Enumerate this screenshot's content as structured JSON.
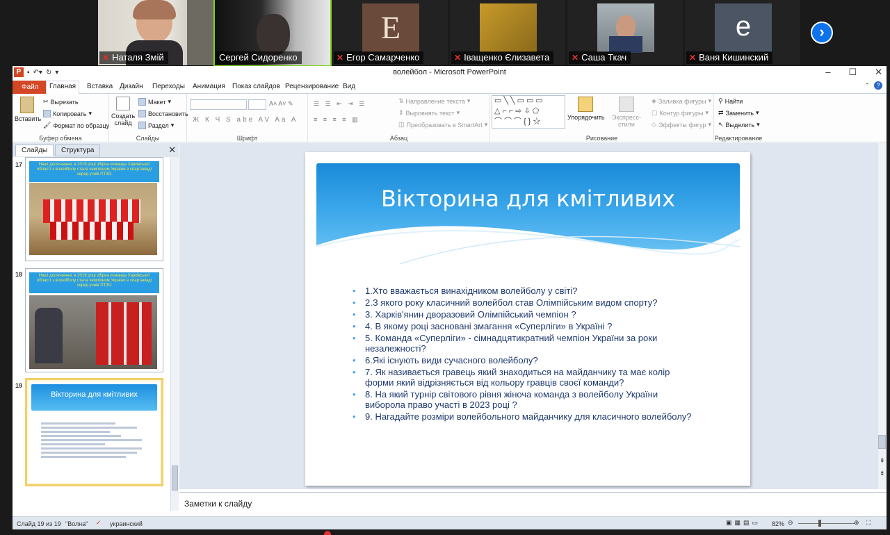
{
  "meeting": {
    "participants": [
      {
        "name": "Наталя Змій",
        "video": "face"
      },
      {
        "name": "Сергей Сидоренко",
        "video": "dark"
      },
      {
        "name": "Егор Самарченко",
        "video": "letter-e"
      },
      {
        "name": "Іващенко Єлизавета",
        "video": "orange"
      },
      {
        "name": "Саша Ткач",
        "video": "face2"
      },
      {
        "name": "Ваня Кишинский",
        "video": "avatar"
      }
    ],
    "avatar_letter": "e",
    "next_icon": "chevron-right-icon"
  },
  "window": {
    "title": "волейбол - Microsoft PowerPoint",
    "qat_icon": "P",
    "controls": [
      "–",
      "☐",
      "✕"
    ]
  },
  "tabs": [
    "Файл",
    "Главная",
    "Вставка",
    "Дизайн",
    "Переходы",
    "Анимация",
    "Показ слайдов",
    "Рецензирование",
    "Вид"
  ],
  "ribbon": {
    "clipboard": {
      "paste": "Вставить",
      "cut": "Вырезать",
      "copy": "Копировать",
      "format": "Формат по образцу",
      "label": "Буфер обмена"
    },
    "slides": {
      "new": "Создать",
      "new2": "слайд",
      "layout": "Макет",
      "reset": "Восстановить",
      "section": "Раздел",
      "label": "Слайды"
    },
    "font": {
      "label": "Шрифт"
    },
    "paragraph": {
      "dir": "Направление текста",
      "align": "Выровнять текст",
      "smartart": "Преобразовать в SmartArt",
      "label": "Абзац"
    },
    "drawing": {
      "arrange": "Упорядочить",
      "quick": "Экспресс-стили",
      "fill": "Заливка фигуры",
      "outline": "Контур фигуры",
      "effects": "Эффекты фигур",
      "label": "Рисование"
    },
    "editing": {
      "find": "Найти",
      "replace": "Заменить",
      "select": "Выделить",
      "label": "Редактирование"
    }
  },
  "pane": {
    "tabs": [
      "Слайды",
      "Структура"
    ],
    "thumbs": [
      {
        "num": "17",
        "caption": "Наші досягнення: в 2019 році збірна команда Харківської області з волейболу стала чемпіоном України в спартакіаді серед учнів ПТЗО"
      },
      {
        "num": "18",
        "caption": "Наші досягнення: в 2019 році збірна команда Харківської області з волейболу стала чемпіоном України в спартакіаді серед учнів ПТЗО"
      },
      {
        "num": "19",
        "caption": "Вікторина для кмітливих"
      }
    ]
  },
  "slide": {
    "title": "Вікторина для кмітливих",
    "questions": [
      "1.Хто вважається винахідником волейболу у світі?",
      "2.З якого року класичний волейбол став Олімпійським видом спорту?",
      "3. Харків'янин дворазовий  Олімпійський чемпіон ?",
      "4. В якому році засновані змагання «Суперліги» в Україні ?",
      "5. Команда  «Суперліги» - сімнадцятикратний чемпіон України за роки незалежності?",
      "6.Які існують види сучасного волейболу?",
      "7. Як називається гравець який знаходиться на майданчику та має колір форми який відрізняється від кольору гравців своєї команди?",
      "8. На який турнір світового рівня жіноча команда з волейболу України виборола право участі в 2023 році ?",
      "9. Нагадайте розміри волейбольного майданчику  для класичного волейболу?"
    ]
  },
  "notes_placeholder": "Заметки к слайду",
  "status": {
    "slide": "Слайд 19 из 19",
    "theme": "\"Волна\"",
    "lang": "украинский",
    "zoom": "82%"
  }
}
